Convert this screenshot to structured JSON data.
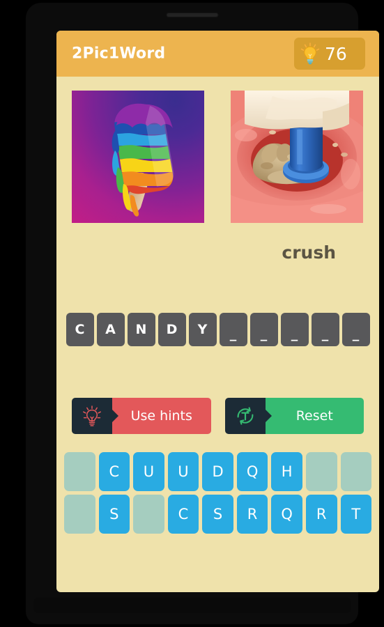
{
  "app": {
    "title": "2Pic1Word"
  },
  "header": {
    "hint_icon": "lightbulb-icon",
    "hint_count": "76"
  },
  "pictures": [
    {
      "name": "picture-left",
      "description": "rainbow popsicle on purple magenta gradient"
    },
    {
      "name": "picture-right",
      "description": "blue pestle crushing crumbs in a red mortar bowl"
    }
  ],
  "answer": {
    "word": "crush"
  },
  "word_tiles": [
    {
      "letter": "C",
      "filled": true
    },
    {
      "letter": "A",
      "filled": true
    },
    {
      "letter": "N",
      "filled": true
    },
    {
      "letter": "D",
      "filled": true
    },
    {
      "letter": "Y",
      "filled": true
    },
    {
      "letter": "_",
      "filled": false
    },
    {
      "letter": "_",
      "filled": false
    },
    {
      "letter": "_",
      "filled": false
    },
    {
      "letter": "_",
      "filled": false
    },
    {
      "letter": "_",
      "filled": false
    }
  ],
  "actions": {
    "hints": {
      "label": "Use hints",
      "icon": "lightbulb-icon",
      "color": "#E3585A"
    },
    "reset": {
      "label": "Reset",
      "icon": "reset-circle-t-icon",
      "color": "#35BB72"
    }
  },
  "keyboard": {
    "rows": [
      [
        {
          "letter": "",
          "used": true
        },
        {
          "letter": "C",
          "used": false
        },
        {
          "letter": "U",
          "used": false
        },
        {
          "letter": "U",
          "used": false
        },
        {
          "letter": "D",
          "used": false
        },
        {
          "letter": "Q",
          "used": false
        },
        {
          "letter": "H",
          "used": false
        },
        {
          "letter": "",
          "used": true
        },
        {
          "letter": "",
          "used": true
        }
      ],
      [
        {
          "letter": "",
          "used": true
        },
        {
          "letter": "S",
          "used": false
        },
        {
          "letter": "",
          "used": true
        },
        {
          "letter": "C",
          "used": false
        },
        {
          "letter": "S",
          "used": false
        },
        {
          "letter": "R",
          "used": false
        },
        {
          "letter": "Q",
          "used": false
        },
        {
          "letter": "R",
          "used": false
        },
        {
          "letter": "T",
          "used": false
        }
      ]
    ]
  },
  "colors": {
    "header": "#EDB44F",
    "card_bg": "#EFE2AB",
    "badge": "#D79F2F",
    "word_tile": "#58585A",
    "key_available": "#29ABE2",
    "key_empty": "#A5CDBF",
    "hints": "#E3585A",
    "reset": "#35BB72",
    "icon_box": "#1C2B36"
  }
}
